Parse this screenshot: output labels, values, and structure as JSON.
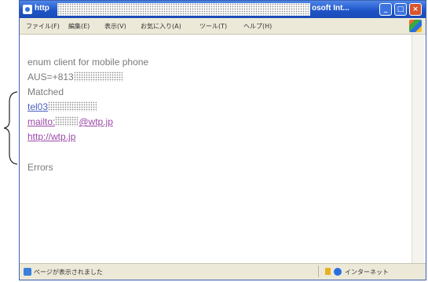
{
  "window": {
    "title_start": "http",
    "title_end": "osoft Int..."
  },
  "controls": {
    "minimize": "_",
    "maximize": "□",
    "close": "×"
  },
  "menu": [
    "ファイル(F)",
    "編集(E)",
    "表示(V)",
    "お気に入り(A)",
    "ツール(T)",
    "ヘルプ(H)"
  ],
  "content": {
    "heading": "enum client for mobile phone",
    "aus_prefix": "AUS=+813",
    "matched": "Matched",
    "links": {
      "tel": "tel03",
      "mailto_prefix": "mailto:",
      "mailto_suffix": "@wtp.jp",
      "http": "http://wtp.jp"
    },
    "errors": "Errors"
  },
  "status": {
    "left": "ページが表示されました",
    "zone": "インターネット"
  },
  "colors": {
    "titlebar": "#1f55c9",
    "link": "#4a5ec0",
    "visited_link": "#9a4aa8",
    "close_button": "#d9552e"
  }
}
